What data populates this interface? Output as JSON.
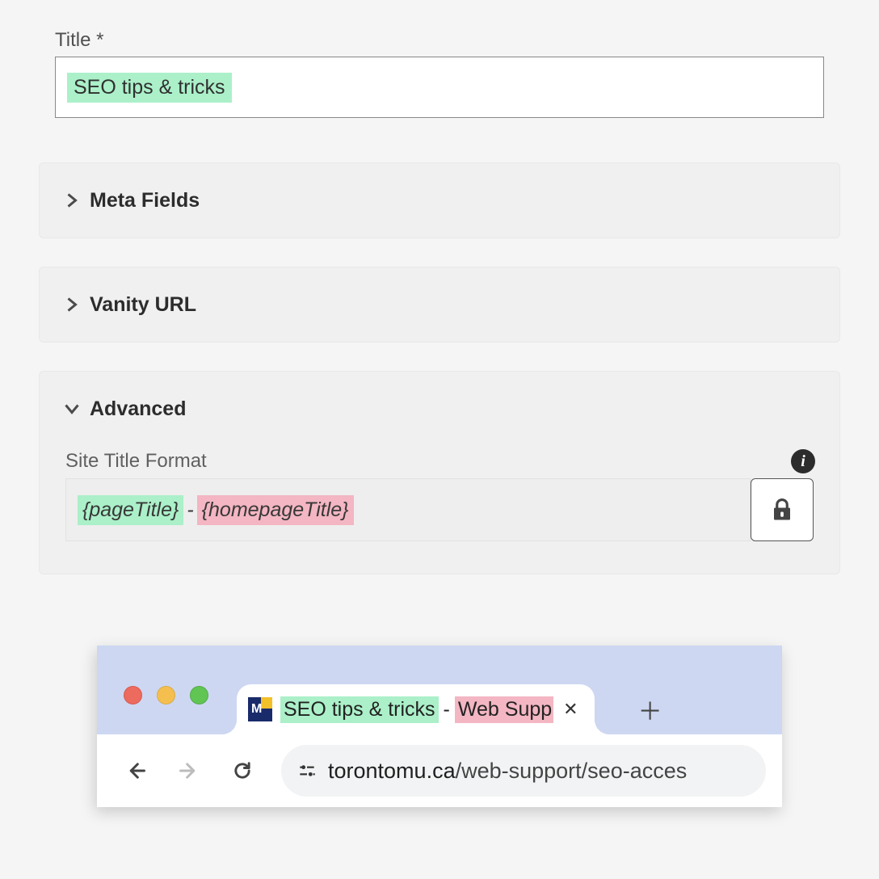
{
  "title": {
    "label": "Title *",
    "value": "SEO tips & tricks",
    "highlight": "green"
  },
  "accordions": {
    "meta_fields": {
      "label": "Meta Fields",
      "expanded": false
    },
    "vanity_url": {
      "label": "Vanity URL",
      "expanded": false
    },
    "advanced": {
      "label": "Advanced",
      "expanded": true
    }
  },
  "advanced": {
    "site_title_format": {
      "label": "Site Title Format",
      "tokens": [
        {
          "text": "{pageTitle}",
          "highlight": "green"
        },
        {
          "text": " - ",
          "highlight": "none"
        },
        {
          "text": "{homepageTitle}",
          "highlight": "pink"
        }
      ],
      "locked": true
    }
  },
  "browser": {
    "favicon_letter": "M",
    "tab": {
      "page_title": {
        "text": "SEO tips & tricks",
        "highlight": "green"
      },
      "separator": " - ",
      "homepage_title": {
        "text": "Web Supp",
        "highlight": "pink",
        "truncated": true
      }
    },
    "url": {
      "host": "torontomu.ca",
      "path": "/web-support/seo-acces"
    }
  }
}
